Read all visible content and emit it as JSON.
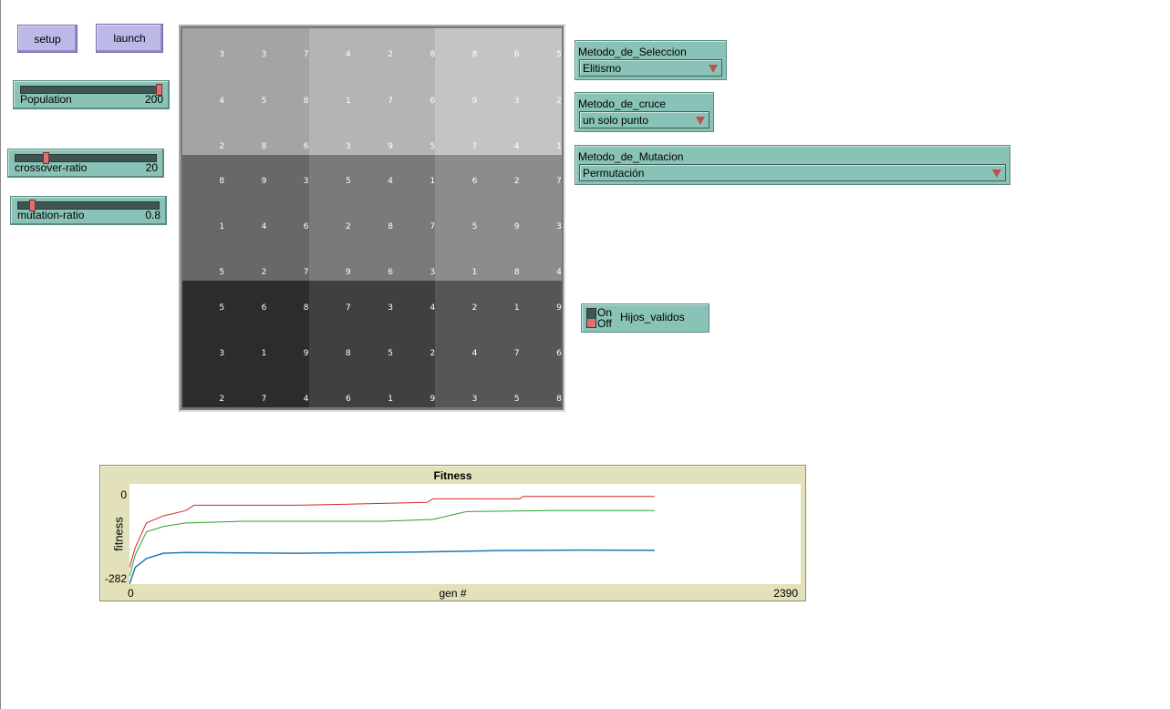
{
  "buttons": {
    "setup": "setup",
    "launch": "launch"
  },
  "sliders": {
    "population": {
      "label": "Population",
      "value": "200",
      "fraction": 1.0
    },
    "crossover": {
      "label": "crossover-ratio",
      "value": "20",
      "fraction": 0.2
    },
    "mutation": {
      "label": "mutation-ratio",
      "value": "0.8",
      "fraction": 0.08
    }
  },
  "choosers": {
    "seleccion": {
      "label": "Metodo_de_Seleccion",
      "value": "Elitismo"
    },
    "cruce": {
      "label": "Metodo_de_cruce",
      "value": "un solo punto"
    },
    "mutacion": {
      "label": "Metodo_de_Mutacion",
      "value": "Permutación"
    }
  },
  "switch": {
    "on_label": "On",
    "off_label": "Off",
    "label": "Hijos_validos",
    "state": "off"
  },
  "grid": {
    "block_colors": [
      [
        "#a4a4a4",
        "#b4b4b4",
        "#c4c4c4"
      ],
      [
        "#686868",
        "#7a7a7a",
        "#8c8c8c"
      ],
      [
        "#2c2c2c",
        "#404040",
        "#565656"
      ]
    ],
    "numbers": [
      [
        3,
        3,
        7,
        4,
        2,
        8,
        8,
        6,
        5
      ],
      [
        4,
        5,
        8,
        1,
        7,
        6,
        9,
        3,
        2
      ],
      [
        2,
        8,
        6,
        3,
        9,
        5,
        7,
        4,
        1
      ],
      [
        8,
        9,
        3,
        5,
        4,
        1,
        6,
        2,
        7
      ],
      [
        1,
        4,
        6,
        2,
        8,
        7,
        5,
        9,
        3
      ],
      [
        5,
        2,
        7,
        9,
        6,
        3,
        1,
        8,
        4
      ],
      [
        5,
        6,
        8,
        7,
        3,
        4,
        2,
        1,
        9
      ],
      [
        3,
        1,
        9,
        8,
        5,
        2,
        4,
        7,
        6
      ],
      [
        2,
        7,
        4,
        6,
        1,
        9,
        3,
        5,
        8
      ]
    ]
  },
  "plot": {
    "title": "Fitness",
    "ylabel": "fitness",
    "xlabel": "gen #",
    "y_max_label": "0",
    "y_min_label": "-282",
    "x_min_label": "0",
    "x_max_label": "2390",
    "colors": {
      "best": "#d62728",
      "average": "#2ca02c",
      "worst": "#1f77b4"
    }
  },
  "chart_data": {
    "type": "line",
    "title": "Fitness",
    "xlabel": "gen #",
    "ylabel": "fitness",
    "xlim": [
      0,
      2390
    ],
    "ylim": [
      -282,
      0
    ],
    "series": [
      {
        "x": [
          0,
          20,
          60,
          120,
          200,
          230,
          600,
          1060,
          1080,
          1390,
          1400,
          1870
        ],
        "values": [
          -235,
          -180,
          -110,
          -90,
          -75,
          -60,
          -60,
          -52,
          -42,
          -42,
          -35,
          -35
        ]
      },
      {
        "x": [
          0,
          20,
          60,
          120,
          200,
          400,
          900,
          1080,
          1200,
          1500,
          1870
        ],
        "values": [
          -260,
          -200,
          -135,
          -120,
          -110,
          -105,
          -105,
          -100,
          -78,
          -75,
          -75
        ]
      },
      {
        "x": [
          0,
          20,
          60,
          120,
          200,
          600,
          1000,
          1300,
          1600,
          1870
        ],
        "values": [
          -282,
          -235,
          -210,
          -195,
          -193,
          -195,
          -192,
          -188,
          -186,
          -187
        ]
      }
    ]
  }
}
